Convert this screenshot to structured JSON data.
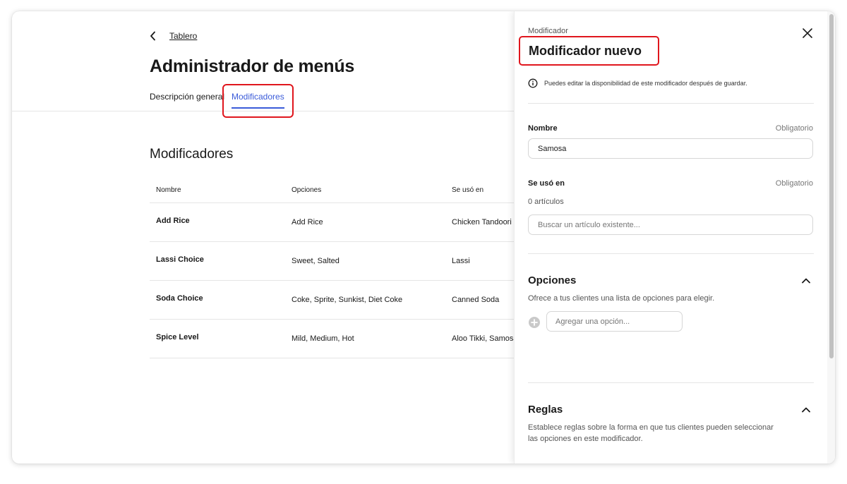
{
  "nav": {
    "back_label": "Tablero"
  },
  "page": {
    "title": "Administrador de menús"
  },
  "tabs": [
    {
      "label": "Descripción general",
      "active": false
    },
    {
      "label": "Modificadores",
      "active": true
    }
  ],
  "modifiers": {
    "section_title": "Modificadores",
    "columns": [
      "Nombre",
      "Opciones",
      "Se usó en"
    ],
    "rows": [
      {
        "name": "Add Rice",
        "options": "Add Rice",
        "used_in": "Chicken Tandoori"
      },
      {
        "name": "Lassi Choice",
        "options": "Sweet, Salted",
        "used_in": "Lassi"
      },
      {
        "name": "Soda Choice",
        "options": "Coke, Sprite, Sunkist, Diet Coke",
        "used_in": "Canned Soda"
      },
      {
        "name": "Spice Level",
        "options": "Mild, Medium, Hot",
        "used_in": "Aloo Tikki, Samosa"
      }
    ]
  },
  "panel": {
    "kicker": "Modificador",
    "title": "Modificador nuevo",
    "info_text": "Puedes editar la disponibilidad de este modificador después de guardar.",
    "name_field": {
      "label": "Nombre",
      "required": "Obligatorio",
      "value": "Samosa"
    },
    "used_in_field": {
      "label": "Se usó en",
      "required": "Obligatorio",
      "count": "0 artículos",
      "placeholder": "Buscar un artículo existente..."
    },
    "options_section": {
      "title": "Opciones",
      "description": "Ofrece a tus clientes una lista de opciones para elegir.",
      "add_placeholder": "Agregar una opción..."
    },
    "rules_section": {
      "title": "Reglas",
      "description_line1": "Establece reglas sobre la forma en que tus clientes pueden seleccionar",
      "description_line2": "las opciones en este modificador."
    }
  },
  "colors": {
    "accent": "#3a5bd9",
    "highlight": "#e0161d",
    "text": "#191919",
    "muted": "#767676"
  },
  "icons": [
    "chevron-left-icon",
    "close-icon",
    "info-icon",
    "chevron-up-icon",
    "add-circle-icon"
  ]
}
